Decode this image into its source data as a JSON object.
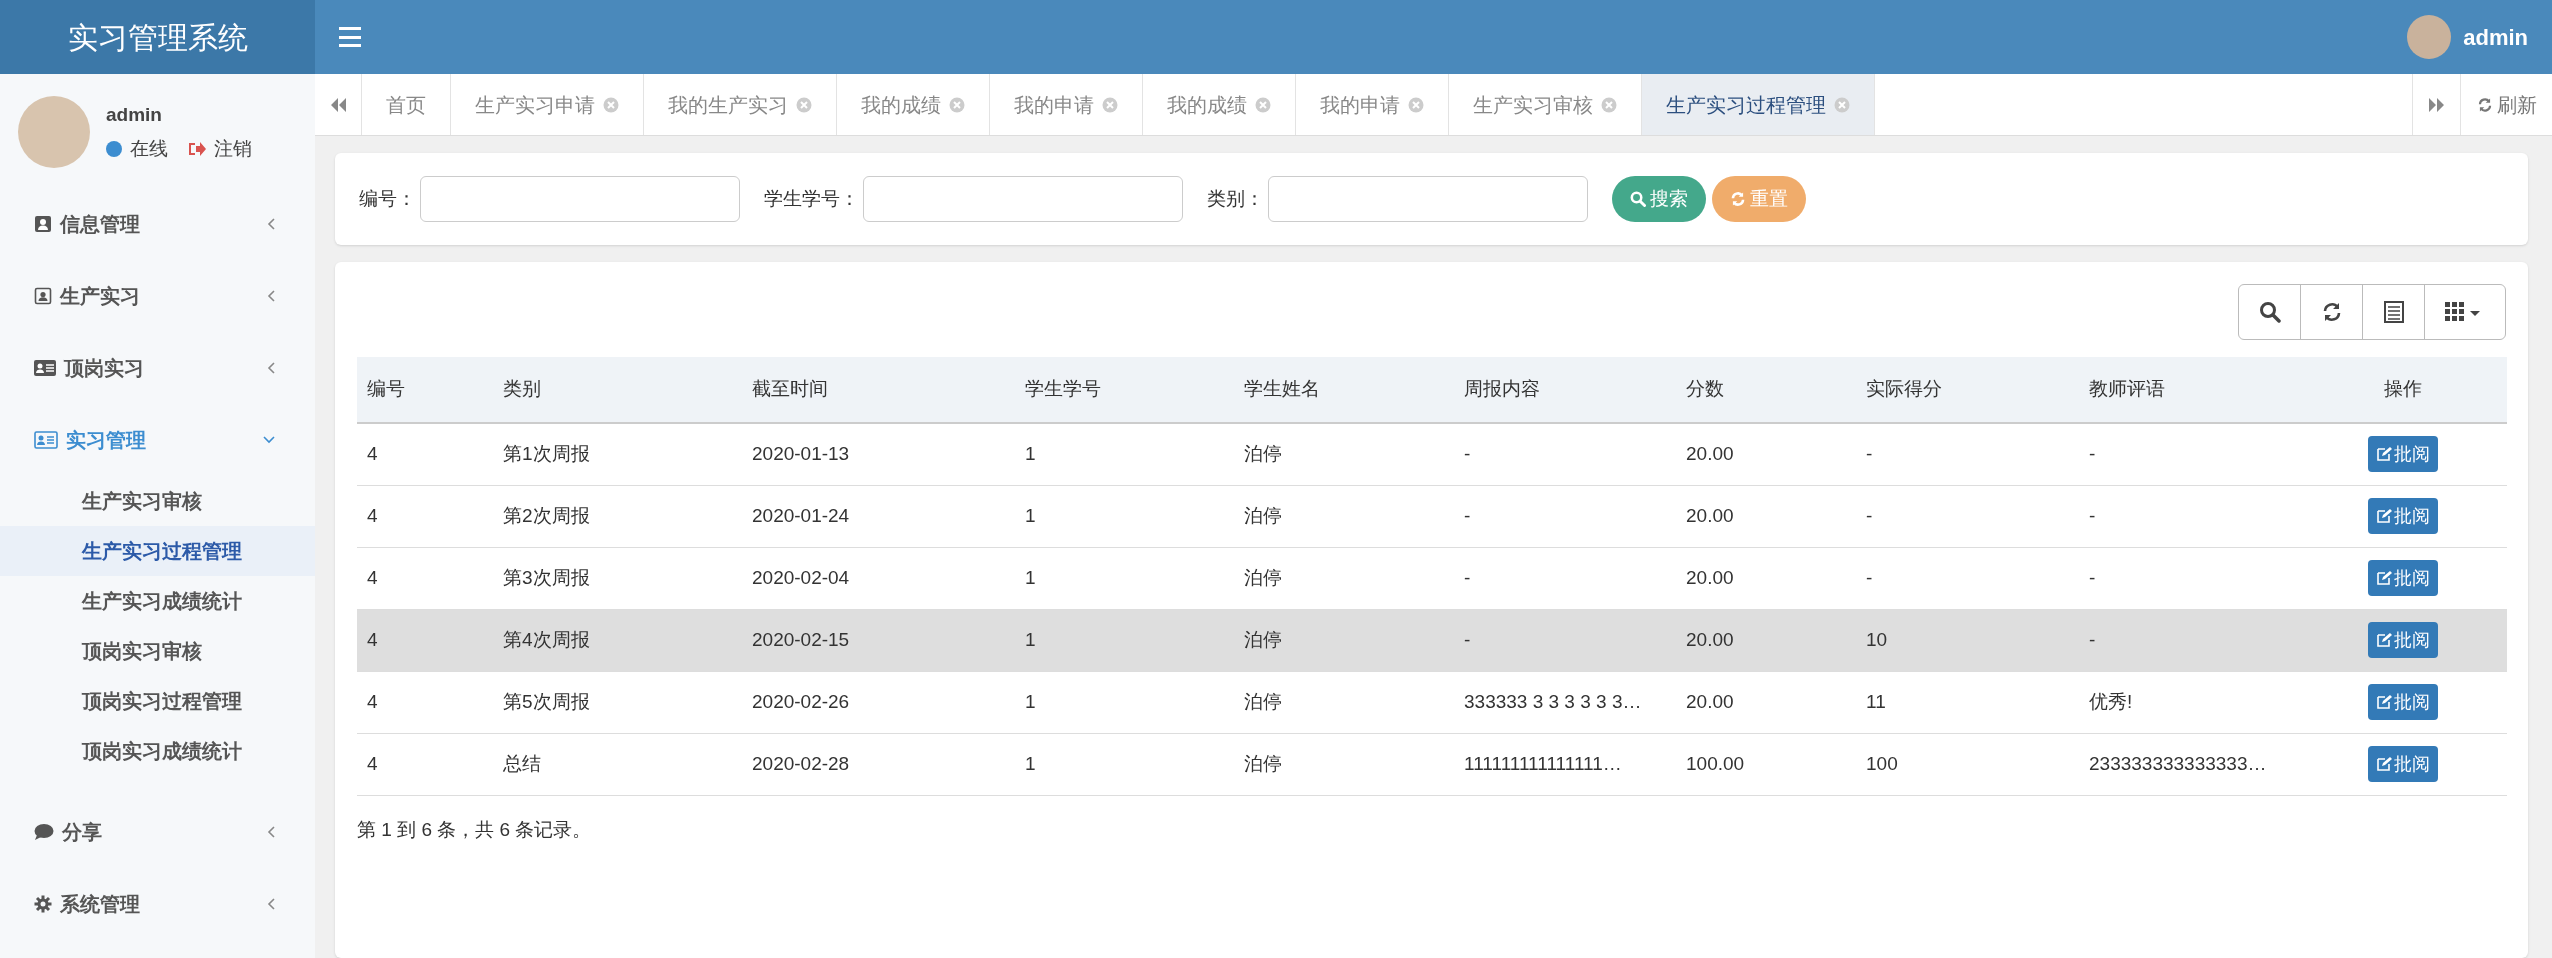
{
  "app_title": "实习管理系统",
  "header": {
    "user": "admin"
  },
  "sidebar": {
    "user": {
      "name": "admin",
      "status": "在线",
      "logout": "注销"
    },
    "menu": [
      {
        "label": "信息管理",
        "expanded": false
      },
      {
        "label": "生产实习",
        "expanded": false
      },
      {
        "label": "顶岗实习",
        "expanded": false
      },
      {
        "label": "实习管理",
        "expanded": true,
        "children": [
          {
            "label": "生产实习审核",
            "selected": false
          },
          {
            "label": "生产实习过程管理",
            "selected": true
          },
          {
            "label": "生产实习成绩统计",
            "selected": false
          },
          {
            "label": "顶岗实习审核",
            "selected": false
          },
          {
            "label": "顶岗实习过程管理",
            "selected": false
          },
          {
            "label": "顶岗实习成绩统计",
            "selected": false
          }
        ]
      },
      {
        "label": "分享",
        "expanded": false
      },
      {
        "label": "系统管理",
        "expanded": false
      }
    ]
  },
  "tabs": [
    {
      "label": "首页",
      "selected": false,
      "closable": false
    },
    {
      "label": "生产实习申请",
      "selected": false,
      "closable": true
    },
    {
      "label": "我的生产实习",
      "selected": false,
      "closable": true
    },
    {
      "label": "我的成绩",
      "selected": false,
      "closable": true
    },
    {
      "label": "我的申请",
      "selected": false,
      "closable": true
    },
    {
      "label": "我的成绩",
      "selected": false,
      "closable": true
    },
    {
      "label": "我的申请",
      "selected": false,
      "closable": true
    },
    {
      "label": "生产实习审核",
      "selected": false,
      "closable": true
    },
    {
      "label": "生产实习过程管理",
      "selected": true,
      "closable": true
    }
  ],
  "refresh": "刷新",
  "search": {
    "fields": [
      {
        "label": "编号："
      },
      {
        "label": "学生学号："
      },
      {
        "label": "类别："
      }
    ],
    "search_button": "搜索",
    "reset_button": "重置"
  },
  "table": {
    "columns": [
      "编号",
      "类别",
      "截至时间",
      "学生学号",
      "学生姓名",
      "周报内容",
      "分数",
      "实际得分",
      "教师评语",
      "操作"
    ],
    "rows": [
      {
        "cells": [
          "4",
          "第1次周报",
          "2020-01-13",
          "1",
          "泊停",
          "-",
          "20.00",
          "-",
          "-"
        ],
        "action": "批阅",
        "highlighted": false
      },
      {
        "cells": [
          "4",
          "第2次周报",
          "2020-01-24",
          "1",
          "泊停",
          "-",
          "20.00",
          "-",
          "-"
        ],
        "action": "批阅",
        "highlighted": false
      },
      {
        "cells": [
          "4",
          "第3次周报",
          "2020-02-04",
          "1",
          "泊停",
          "-",
          "20.00",
          "-",
          "-"
        ],
        "action": "批阅",
        "highlighted": false
      },
      {
        "cells": [
          "4",
          "第4次周报",
          "2020-02-15",
          "1",
          "泊停",
          "-",
          "20.00",
          "10",
          "-"
        ],
        "action": "批阅",
        "highlighted": true
      },
      {
        "cells": [
          "4",
          "第5次周报",
          "2020-02-26",
          "1",
          "泊停",
          "333333 3 3 3 3 3 3…",
          "20.00",
          "11",
          "优秀!"
        ],
        "action": "批阅",
        "highlighted": false
      },
      {
        "cells": [
          "4",
          "总结",
          "2020-02-28",
          "1",
          "泊停",
          "111111111111111…",
          "100.00",
          "100",
          "233333333333333…"
        ],
        "action": "批阅",
        "highlighted": false
      }
    ],
    "footer": "第 1 到 6 条，共 6 条记录。"
  }
}
